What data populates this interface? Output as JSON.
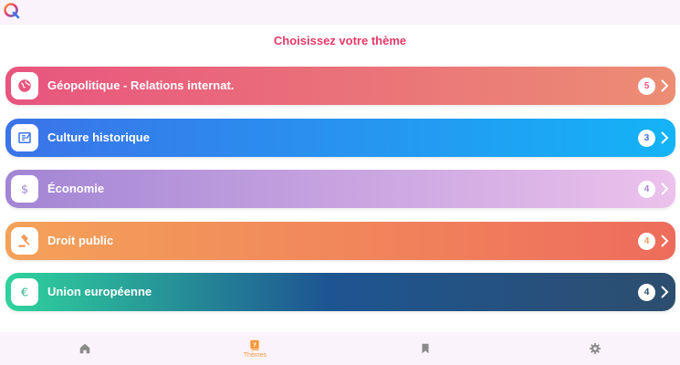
{
  "header": {
    "logo_icon": "quiz-logo-icon",
    "title": "Choisissez votre thème"
  },
  "themes": [
    {
      "label": "Géopolitique - Relations internat.",
      "count": "5",
      "icon": "globe-icon",
      "gradient": [
        "#e8557f",
        "#ec8d74"
      ],
      "accent": "#e8557f"
    },
    {
      "label": "Culture historique",
      "count": "3",
      "icon": "history-book-icon",
      "gradient": [
        "#3b73e8",
        "#14b3f7"
      ],
      "accent": "#3b73e8"
    },
    {
      "label": "Économie",
      "count": "4",
      "icon": "dollar-icon",
      "gradient": [
        "#a285d4",
        "#ecc2ec"
      ],
      "accent": "#a285d4"
    },
    {
      "label": "Droit public",
      "count": "4",
      "icon": "gavel-icon",
      "gradient": [
        "#f4a25a",
        "#ee6c5c"
      ],
      "accent": "#f29a59"
    },
    {
      "label": "Union européenne",
      "count": "4",
      "icon": "euro-icon",
      "gradient": [
        "#2fd39d",
        "#1d5592",
        "#2d4e6e"
      ],
      "accent": "#2fb58f"
    }
  ],
  "bottom_nav": {
    "items": [
      {
        "icon": "home-icon",
        "label": ""
      },
      {
        "icon": "themes-icon",
        "label": "Thèmes",
        "active": true
      },
      {
        "icon": "bookmark-icon",
        "label": ""
      },
      {
        "icon": "settings-gear-icon",
        "label": ""
      }
    ],
    "active_color": "#f39a3c",
    "inactive_color": "#8a8a8a"
  }
}
